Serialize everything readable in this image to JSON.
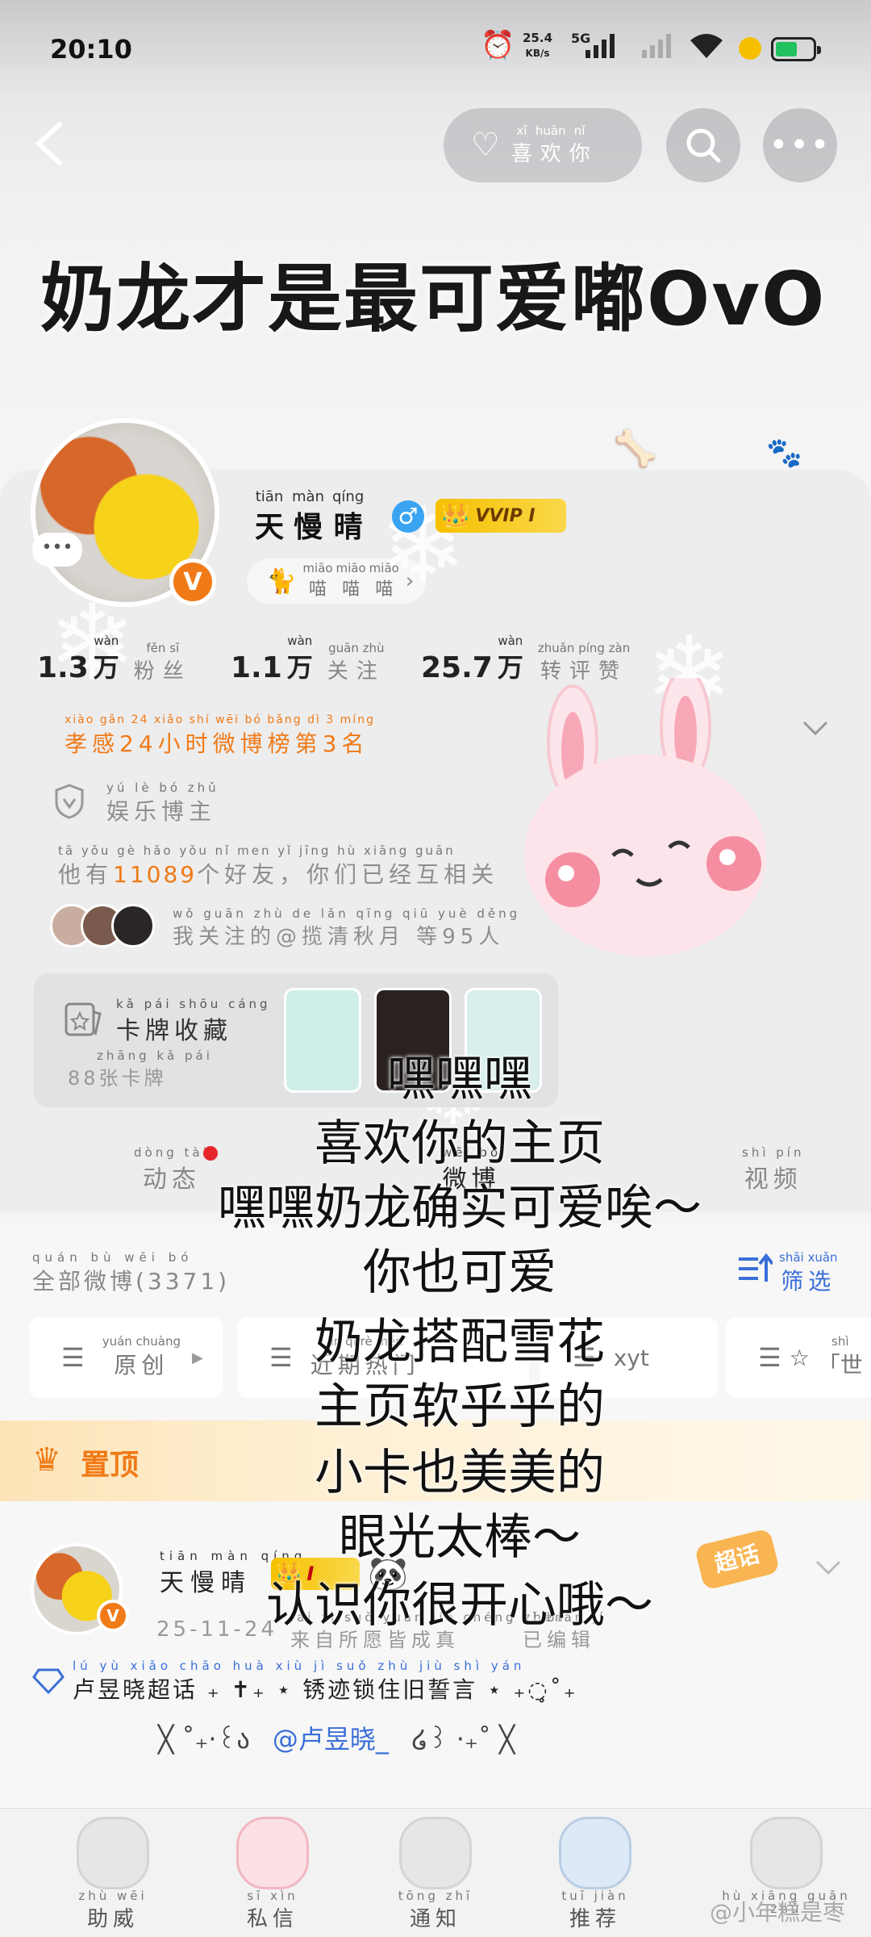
{
  "status_bar": {
    "time": "20:10",
    "net_speed": "25.4",
    "net_unit": "KB/s",
    "network": "5G"
  },
  "header": {
    "like_label": "喜欢你",
    "like_pinyin": [
      "xǐ",
      "huān",
      "nǐ"
    ]
  },
  "cover_title": "奶龙才是最可爱嘟OvO",
  "profile": {
    "name": "天慢晴",
    "name_pinyin": [
      "tiān",
      "màn",
      "qíng"
    ],
    "gender_icon": "male-icon",
    "vip_label": "VVIP I",
    "tag": "喵喵喵",
    "tag_pinyin": [
      "miāo",
      "miāo",
      "miāo"
    ],
    "verified_badge": "V",
    "stats": [
      {
        "value": "1.3",
        "unit": "万",
        "unit_pinyin": "wàn",
        "label": "粉丝",
        "label_pinyin": "fěn sī"
      },
      {
        "value": "1.1",
        "unit": "万",
        "unit_pinyin": "wàn",
        "label": "关注",
        "label_pinyin": "guān zhù"
      },
      {
        "value": "25.7",
        "unit": "万",
        "unit_pinyin": "wàn",
        "label": "转评赞",
        "label_pinyin": "zhuǎn píng zàn"
      }
    ],
    "rank_text": "孝感24小时微博榜第3名",
    "rank_pinyin": "xiào gǎn 24 xiǎo shí wēi bó bǎng dì 3 míng",
    "role": "娱乐博主",
    "role_pinyin": "yú lè bó zhǔ",
    "friends_prefix": "他有",
    "friends_count": "11089",
    "friends_suffix": "个好友，你们已经互相关",
    "friends_pinyin": "tā yǒu  gè hǎo yǒu nǐ men yǐ jīng hù xiāng guān",
    "following_text": "我关注的@揽清秋月 等95人",
    "following_pinyin": "wǒ guān zhù de  lǎn qīng qiū yuè  děng"
  },
  "card_collection": {
    "title": "卡牌收藏",
    "title_pinyin": "kǎ pái shōu cáng",
    "count_text": "88张卡牌",
    "count_pinyin": "zhāng kǎ pái",
    "card_colors": [
      "#cfeee8",
      "#2a2220",
      "#d8efec"
    ],
    "card_tags": [
      "14",
      "15",
      "16"
    ]
  },
  "tabs": [
    {
      "label": "动态",
      "pinyin": "dòng tài"
    },
    {
      "label": "微博",
      "pinyin": "wēi bó"
    },
    {
      "label": "视频",
      "pinyin": "shì pín"
    }
  ],
  "feed": {
    "all_label": "全部微博(3371)",
    "all_pinyin": "quán bù wēi bó",
    "filter_label": "筛选",
    "filter_pinyin": "shāi xuǎn",
    "chips": [
      {
        "label": "原创",
        "pinyin": "yuán chuàng"
      },
      {
        "label": "近期热门",
        "pinyin": "jìn qī rè mén"
      },
      {
        "label": "xyt",
        "pinyin": ""
      },
      {
        "label": "「世",
        "pinyin": "shì"
      }
    ],
    "pinned_label": "置顶",
    "post": {
      "author": "天慢晴",
      "author_pinyin": "tiān màn qíng",
      "vip": "I",
      "date": "25-11-24",
      "source": "来自所愿皆成真",
      "source_pinyin": "lái zì suǒ yuàn jiē chéng zhēn",
      "edited": "已编辑",
      "edited_pinyin": "yǐ biān jí",
      "topic": "卢昱晓超话",
      "topic_pinyin": "lú yù xiǎo chāo huà",
      "chaohua_badge": "超话",
      "line1": "卢昱晓超话 ₊ ✝︎₊ ⋆ 锈迹锁住旧誓言 ⋆ ₊◌̥˚₊",
      "line1_pinyin": "lú yù xiǎo chāo huà   xiù jì suǒ zhù jiù shì yán",
      "line2_a": "╳ ˚₊‧꒰ა",
      "line2_mention": "@卢昱晓_",
      "line2_b": "໒꒱ ‧₊˚ ╳"
    }
  },
  "overlay_lines": [
    "嘿嘿嘿",
    "喜欢你的主页",
    "嘿嘿奶龙确实可爱唉～",
    "你也可爱",
    "奶龙搭配雪花",
    "主页软乎乎的",
    "小卡也美美的",
    "眼光太棒～",
    "认识你很开心哦～"
  ],
  "tabbar": [
    {
      "label": "助威",
      "pinyin": "zhù wēi"
    },
    {
      "label": "私信",
      "pinyin": "sī xìn"
    },
    {
      "label": "通知",
      "pinyin": "tōng zhī"
    },
    {
      "label": "推荐",
      "pinyin": "tuī jiàn"
    },
    {
      "label": "",
      "pinyin": "hù xiāng guān zhù"
    }
  ],
  "watermark": "@小年糕是枣",
  "colors": {
    "accent_orange": "#f07a17",
    "link_blue": "#3a6fd8",
    "gender_blue": "#3aa4f2",
    "vip_gold": "#f6c000"
  }
}
